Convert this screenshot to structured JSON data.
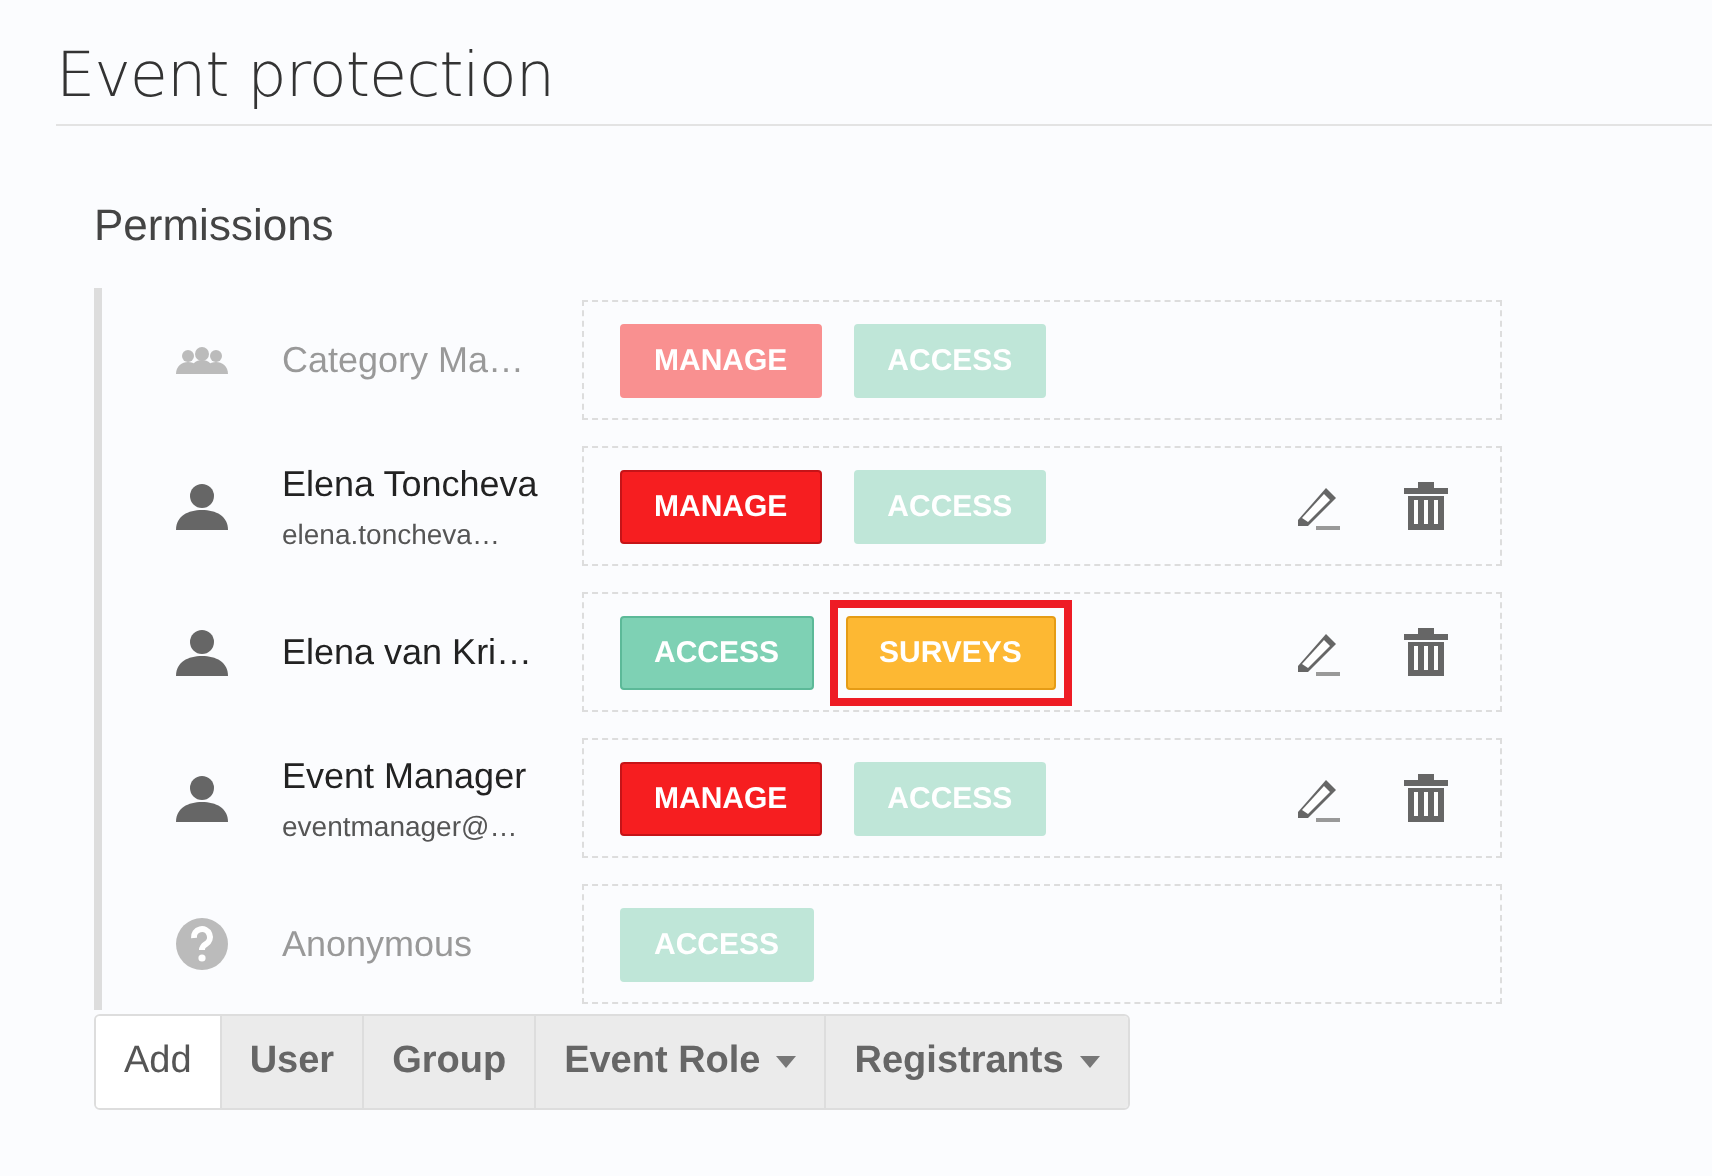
{
  "title": "Event protection",
  "section": "Permissions",
  "rows": [
    {
      "kind": "group",
      "name": "Category Ma…",
      "dimmed": true,
      "tags": [
        {
          "kind": "manage",
          "label": "MANAGE",
          "active": false,
          "highlighted": false
        },
        {
          "kind": "access",
          "label": "ACCESS",
          "active": false,
          "highlighted": false
        }
      ],
      "actions": false
    },
    {
      "kind": "user",
      "name": "Elena Toncheva",
      "email": "elena.toncheva…",
      "dimmed": false,
      "tags": [
        {
          "kind": "manage",
          "label": "MANAGE",
          "active": true,
          "highlighted": false
        },
        {
          "kind": "access",
          "label": "ACCESS",
          "active": false,
          "highlighted": false
        }
      ],
      "actions": true
    },
    {
      "kind": "user",
      "name": "Elena van Kri…",
      "dimmed": false,
      "tags": [
        {
          "kind": "access",
          "label": "ACCESS",
          "active": true,
          "highlighted": false
        },
        {
          "kind": "surveys",
          "label": "SURVEYS",
          "active": true,
          "highlighted": true
        }
      ],
      "actions": true
    },
    {
      "kind": "user",
      "name": "Event Manager",
      "email": "eventmanager@…",
      "dimmed": false,
      "tags": [
        {
          "kind": "manage",
          "label": "MANAGE",
          "active": true,
          "highlighted": false
        },
        {
          "kind": "access",
          "label": "ACCESS",
          "active": false,
          "highlighted": false
        }
      ],
      "actions": true
    },
    {
      "kind": "unknown",
      "name": "Anonymous",
      "dimmed": true,
      "tags": [
        {
          "kind": "access",
          "label": "ACCESS",
          "active": false,
          "highlighted": false
        }
      ],
      "actions": false
    }
  ],
  "add_bar": [
    {
      "label": "Add",
      "kind": "label"
    },
    {
      "label": "User",
      "kind": "button"
    },
    {
      "label": "Group",
      "kind": "button"
    },
    {
      "label": "Event Role",
      "kind": "dropdown"
    },
    {
      "label": "Registrants",
      "kind": "dropdown"
    }
  ]
}
